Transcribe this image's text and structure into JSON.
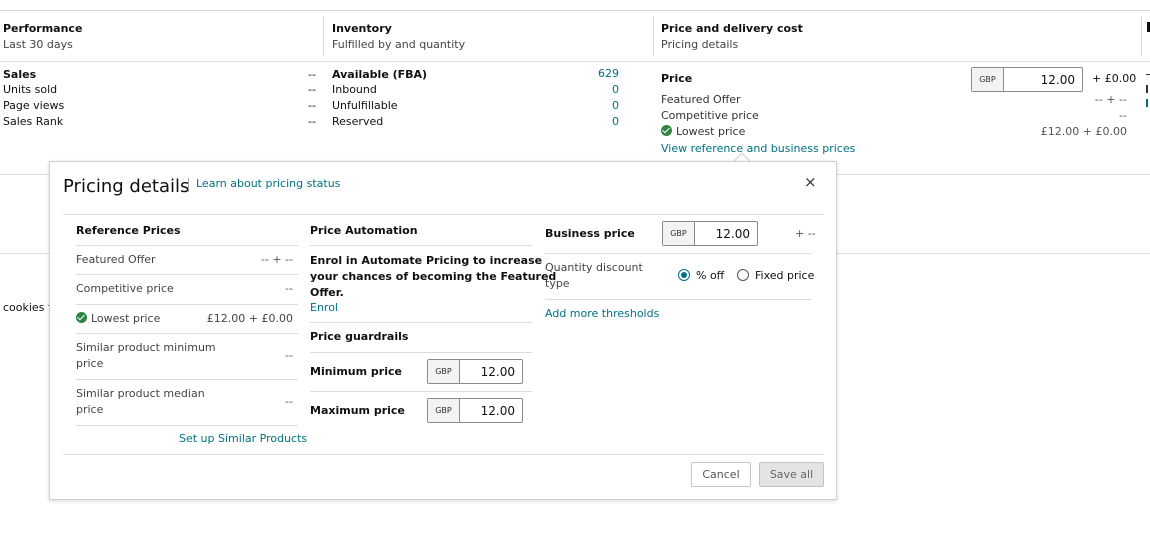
{
  "header": {
    "performance": {
      "title": "Performance",
      "sub": "Last 30 days"
    },
    "inventory": {
      "title": "Inventory",
      "sub": "Fulfilled by and quantity"
    },
    "price": {
      "title": "Price and delivery cost",
      "sub": "Pricing details"
    }
  },
  "performance": {
    "rows": [
      {
        "label": "Sales",
        "value": "--"
      },
      {
        "label": "Units sold",
        "value": "--"
      },
      {
        "label": "Page views",
        "value": "--"
      },
      {
        "label": "Sales Rank",
        "value": "--"
      }
    ]
  },
  "inventory": {
    "rows": [
      {
        "label": "Available (FBA)",
        "value": "629"
      },
      {
        "label": "Inbound",
        "value": "0"
      },
      {
        "label": "Unfulfillable",
        "value": "0"
      },
      {
        "label": "Reserved",
        "value": "0"
      }
    ]
  },
  "price_col": {
    "title": "Price",
    "currency": "GBP",
    "value": "12.00",
    "delivery": "+ £0.00",
    "rows": [
      {
        "label": "Featured Offer",
        "value": "-- + --"
      },
      {
        "label": "Competitive price",
        "value": "--"
      },
      {
        "label": "Lowest price",
        "value": "£12.00 + £0.00"
      }
    ],
    "view_link": "View reference and business prices"
  },
  "cookies_text": "cookies fo",
  "modal": {
    "title": "Pricing details",
    "learn_link": "Learn about pricing status",
    "reference": {
      "title": "Reference Prices",
      "rows": [
        {
          "label": "Featured Offer",
          "value": "-- + --"
        },
        {
          "label": "Competitive price",
          "value": "--"
        },
        {
          "label": "Lowest price",
          "value": "£12.00 + £0.00"
        },
        {
          "label1": "Similar product minimum",
          "label2": "price",
          "value": "--"
        },
        {
          "label1": "Similar product median",
          "label2": "price",
          "value": "--"
        }
      ],
      "setup_link": "Set up Similar Products"
    },
    "automation": {
      "title": "Price Automation",
      "enrol_text1": "Enrol in Automate Pricing to increase",
      "enrol_text2": "your chances of becoming the Featured",
      "enrol_text3": "Offer.",
      "enrol_link": "Enrol",
      "guardrails_title": "Price guardrails",
      "min_label": "Minimum price",
      "min_currency": "GBP",
      "min_value": "12.00",
      "max_label": "Maximum price",
      "max_currency": "GBP",
      "max_value": "12.00"
    },
    "business": {
      "label": "Business price",
      "currency": "GBP",
      "value": "12.00",
      "suffix": "+ --",
      "qd_label1": "Quantity discount",
      "qd_label2": "type",
      "opt_percent": "% off",
      "opt_fixed": "Fixed price",
      "add_link": "Add more thresholds"
    },
    "cancel": "Cancel",
    "save": "Save all"
  },
  "icons": {
    "check": "check-circle-icon",
    "close": "close-icon"
  }
}
